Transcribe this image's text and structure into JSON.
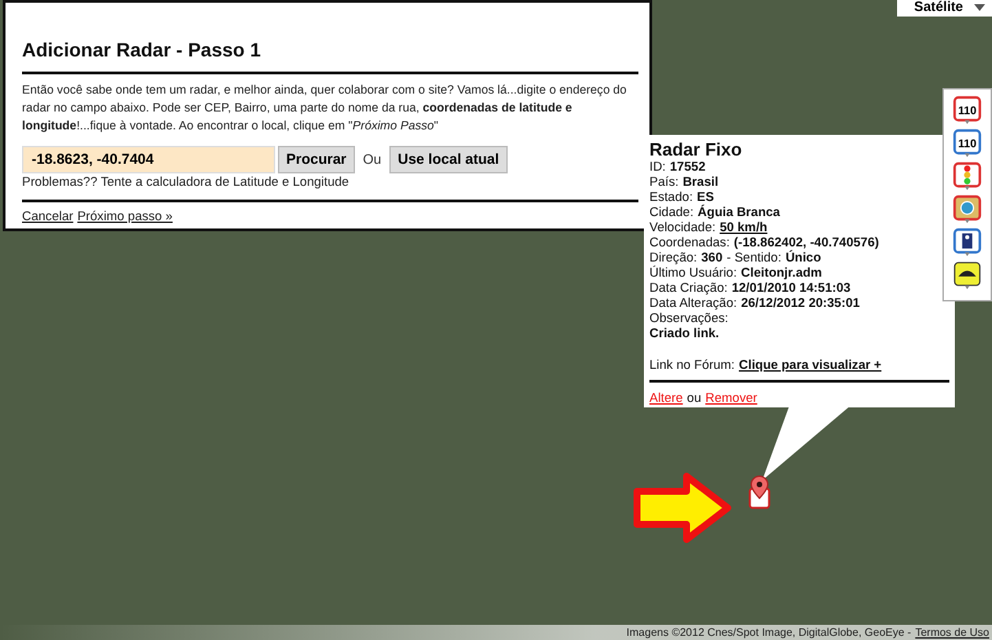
{
  "map_type": {
    "label": "Satélite"
  },
  "dialog": {
    "title": "Adicionar Radar - Passo 1",
    "intro": "Então você sabe onde tem um radar, e melhor ainda, quer colaborar com o site? Vamos lá...digite o endereço do radar no campo abaixo. Pode ser CEP, Bairro, uma parte do nome da rua, **coordenadas de latitude e longitude**!...fique à vontade. Ao encontrar o local, clique em \"*Próximo Passo*\"",
    "search": {
      "value": "-18.8623, -40.7404"
    },
    "search_button": "Procurar",
    "or": "Ou",
    "location_button": "Use local atual",
    "help": "Problemas?? Tente a calculadora de Latitude e Longitude",
    "links": [
      "Cancelar",
      "Próximo passo »"
    ]
  },
  "info": {
    "title": "Radar Fixo",
    "lines": [
      [
        {
          "kind": "label",
          "text": "ID:"
        },
        {
          "kind": "value",
          "text": "17552"
        }
      ],
      [
        {
          "kind": "label",
          "text": "País:"
        },
        {
          "kind": "value",
          "text": "Brasil"
        }
      ],
      [
        {
          "kind": "label",
          "text": "Estado:"
        },
        {
          "kind": "value",
          "text": "ES"
        }
      ],
      [
        {
          "kind": "label",
          "text": "Cidade:"
        },
        {
          "kind": "value",
          "text": "Águia Branca"
        }
      ],
      [
        {
          "kind": "label",
          "text": "Velocidade:"
        },
        {
          "kind": "link",
          "text": "50 km/h"
        }
      ],
      [
        {
          "kind": "label",
          "text": "Coordenadas:"
        },
        {
          "kind": "value",
          "text": "(-18.862402, -40.740576)"
        }
      ],
      [
        {
          "kind": "label",
          "text": "Direção:"
        },
        {
          "kind": "value",
          "text": "360"
        },
        {
          "kind": "label",
          "text": "- Sentido:"
        },
        {
          "kind": "value",
          "text": "Único"
        }
      ],
      [
        {
          "kind": "label",
          "text": "Último Usuário:"
        },
        {
          "kind": "value",
          "text": "Cleitonjr.adm"
        }
      ],
      [
        {
          "kind": "label",
          "text": "Data Criação:"
        },
        {
          "kind": "value",
          "text": "12/01/2010 14:51:03"
        }
      ],
      [
        {
          "kind": "label",
          "text": "Data Alteração:"
        },
        {
          "kind": "value",
          "text": "26/12/2012 20:35:01"
        }
      ],
      [
        {
          "kind": "label",
          "text": "Observações:"
        }
      ],
      [
        {
          "kind": "value",
          "text": "Criado link."
        }
      ]
    ],
    "forum": [
      {
        "kind": "label",
        "text": "Link no Fórum:"
      },
      {
        "kind": "link",
        "text": "Clique para visualizar +"
      }
    ],
    "actions": [
      {
        "kind": "danger",
        "text": "Altere"
      },
      {
        "kind": "label",
        "text": "ou"
      },
      {
        "kind": "danger",
        "text": "Remover"
      }
    ]
  },
  "legend": [
    {
      "kind": "speed-red",
      "text": "110"
    },
    {
      "kind": "speed-blue",
      "text": "110"
    },
    {
      "kind": "traffic-light"
    },
    {
      "kind": "badge"
    },
    {
      "kind": "person"
    },
    {
      "kind": "bump"
    }
  ],
  "attribution": {
    "text": "Imagens ©2012 Cnes/Spot Image, DigitalGlobe, GeoEye -",
    "link": "Termos de Uso"
  }
}
